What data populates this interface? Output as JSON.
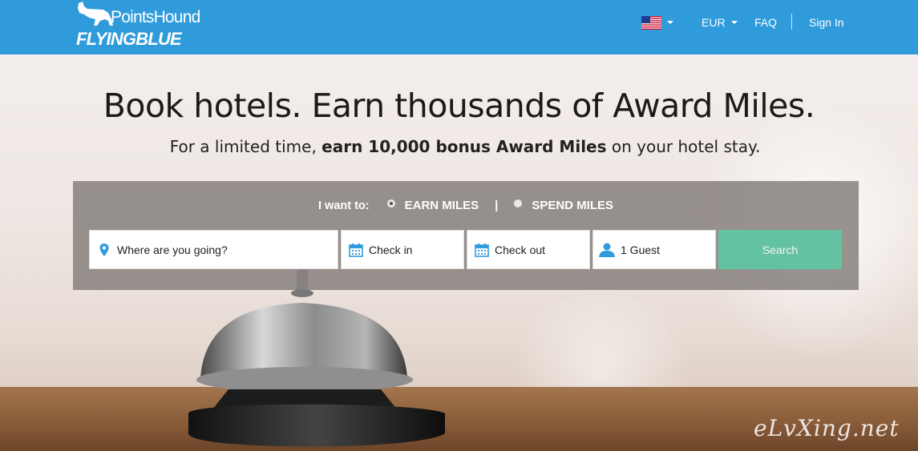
{
  "header": {
    "brand_top": "PointsHound",
    "brand_bottom": "FLYINGBLUE",
    "currency": "EUR",
    "faq": "FAQ",
    "sign_in": "Sign In"
  },
  "hero": {
    "headline": "Book hotels. Earn thousands of Award Miles.",
    "sub_prefix": "For a limited time, ",
    "sub_bold": "earn 10,000 bonus Award Miles",
    "sub_suffix": " on your hotel stay."
  },
  "search": {
    "mode_label": "I want to:",
    "earn_label": "EARN MILES",
    "separator": "|",
    "spend_label": "SPEND MILES",
    "selected_mode": "earn",
    "destination_placeholder": "Where are you going?",
    "check_in_placeholder": "Check in",
    "check_out_placeholder": "Check out",
    "guests_value": "1 Guest",
    "search_label": "Search"
  },
  "watermark": "eLvXing.net",
  "colors": {
    "header_bg": "#2f9bdb",
    "search_button": "#63c2a2",
    "icon_blue": "#2f9bdb"
  },
  "icons": [
    "dog-logo-icon",
    "us-flag-icon",
    "location-pin-icon",
    "calendar-icon",
    "user-icon"
  ]
}
